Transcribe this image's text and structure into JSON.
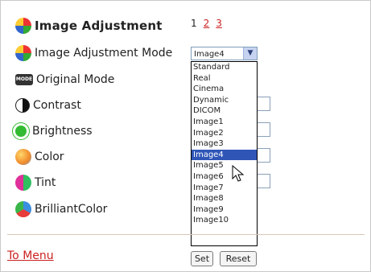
{
  "header": {
    "title": "Image Adjustment",
    "pages": [
      "1",
      "2",
      "3"
    ]
  },
  "rows": [
    {
      "label": "Image Adjustment Mode",
      "icon": "colorwheel-icon"
    },
    {
      "label": "Original Mode",
      "icon": "mode-icon",
      "icon_text": "MODE"
    },
    {
      "label": "Contrast",
      "icon": "contrast-icon"
    },
    {
      "label": "Brightness",
      "icon": "brightness-icon"
    },
    {
      "label": "Color",
      "icon": "color-icon"
    },
    {
      "label": "Tint",
      "icon": "tint-icon"
    },
    {
      "label": "BrilliantColor",
      "icon": "brilliantcolor-icon"
    }
  ],
  "mode_select": {
    "value": "Image4",
    "options": [
      "Standard",
      "Real",
      "Cinema",
      "Dynamic",
      "DICOM",
      "Image1",
      "Image2",
      "Image3",
      "Image4",
      "Image5",
      "Image6",
      "Image7",
      "Image8",
      "Image9",
      "Image10"
    ],
    "selected_index": 8
  },
  "footer": {
    "to_menu": "To Menu",
    "set": "Set",
    "reset": "Reset"
  },
  "colors": {
    "link": "#cc2222",
    "selection": "#2f56b7"
  }
}
